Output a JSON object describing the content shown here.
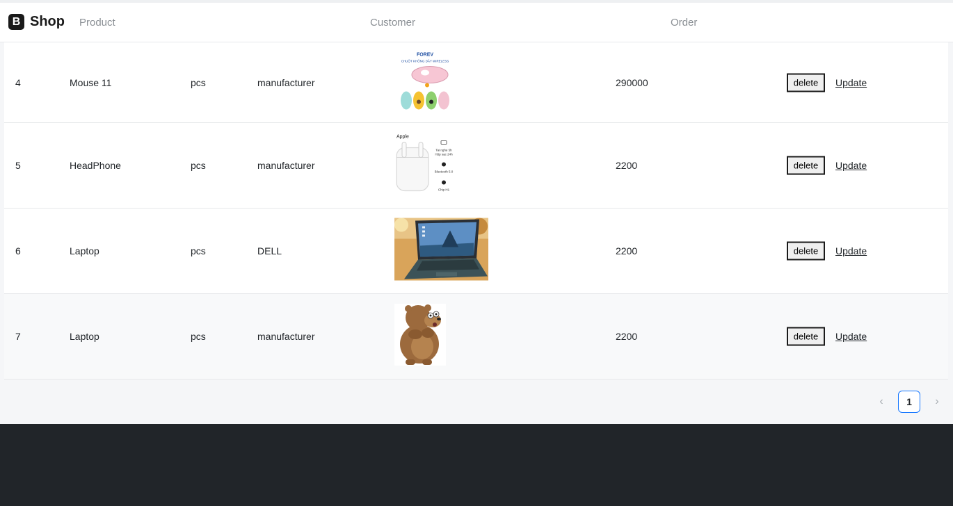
{
  "navbar": {
    "brand_logo": "B",
    "brand_name": "Shop",
    "links": [
      "Product",
      "Customer",
      "Order"
    ]
  },
  "table": {
    "rows": [
      {
        "id": "4",
        "name": "Mouse 11",
        "unit": "pcs",
        "supplier": "manufacturer",
        "image_icon": "wireless-mouse-product-image",
        "price": "290000"
      },
      {
        "id": "5",
        "name": "HeadPhone",
        "unit": "pcs",
        "supplier": "manufacturer",
        "image_icon": "airpods-product-image",
        "price": "2200"
      },
      {
        "id": "6",
        "name": "Laptop",
        "unit": "pcs",
        "supplier": "DELL",
        "image_icon": "laptop-product-image",
        "price": "2200"
      },
      {
        "id": "7",
        "name": "Laptop",
        "unit": "pcs",
        "supplier": "manufacturer",
        "image_icon": "bear-cartoon-image",
        "price": "2200"
      }
    ],
    "delete_label": "delete",
    "update_label": "Update"
  },
  "pagination": {
    "prev_icon": "‹",
    "current_page": "1",
    "next_icon": "›"
  },
  "colors": {
    "accent": "#1677ff",
    "footer": "#212529"
  }
}
